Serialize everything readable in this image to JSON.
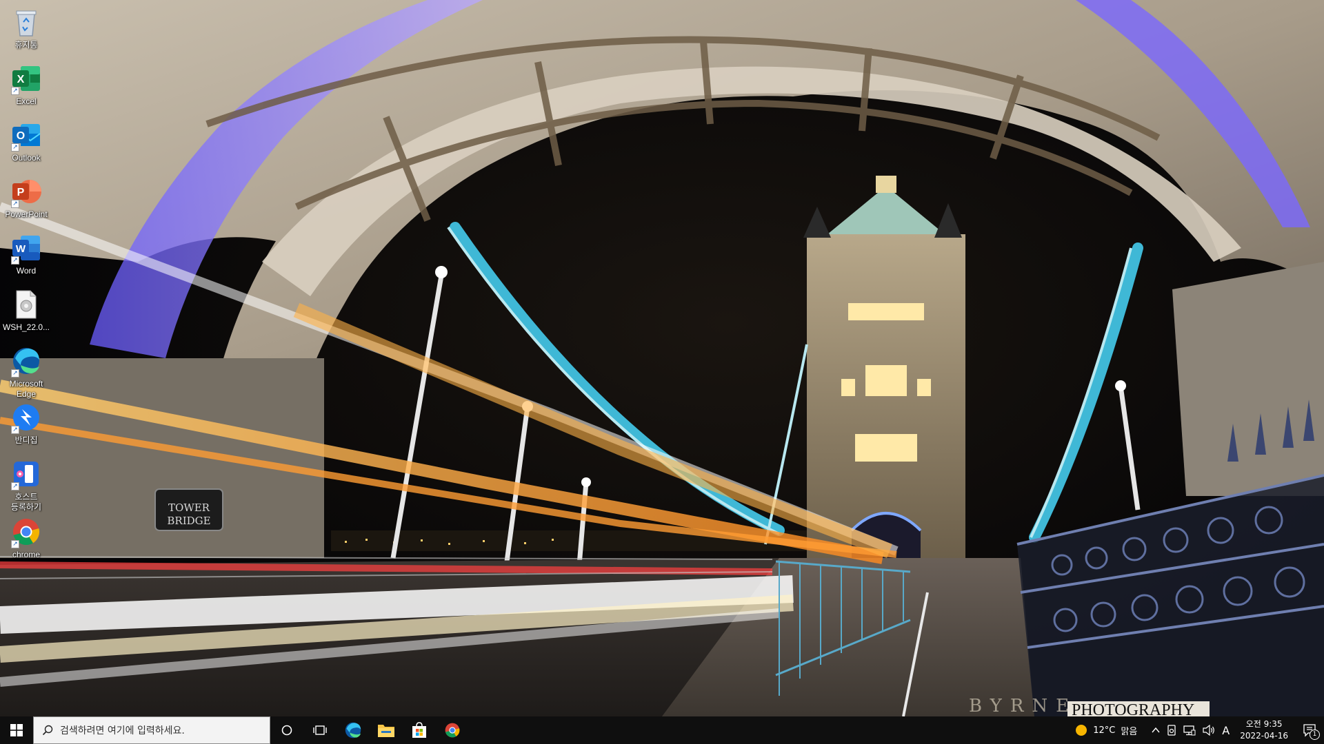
{
  "desktop": {
    "icons": [
      {
        "id": "recycle",
        "label": "휴지통",
        "icon": "recycle-bin-icon"
      },
      {
        "id": "excel",
        "label": "Excel",
        "icon": "excel-icon",
        "color": "#107C41"
      },
      {
        "id": "outlook",
        "label": "Outlook",
        "icon": "outlook-icon",
        "color": "#0F6CBD"
      },
      {
        "id": "powerpoint",
        "label": "PowerPoint",
        "icon": "powerpoint-icon",
        "color": "#C43E1C"
      },
      {
        "id": "word",
        "label": "Word",
        "icon": "word-icon",
        "color": "#185ABD"
      },
      {
        "id": "wsh",
        "label": "WSH_22.0...",
        "icon": "file-icon"
      },
      {
        "id": "edge",
        "label": "Microsoft Edge",
        "icon": "edge-icon"
      },
      {
        "id": "bandizip",
        "label": "반디집",
        "icon": "bandizip-icon",
        "color": "#1E7CF2"
      },
      {
        "id": "host",
        "label": "호스트 등록하기",
        "icon": "host-register-icon",
        "color": "#2468d8"
      },
      {
        "id": "chrome",
        "label": "chrome",
        "icon": "chrome-icon"
      }
    ],
    "wallpaper": {
      "sign_line1": "TOWER",
      "sign_line2": "BRIDGE",
      "watermark_left": "BYRNE",
      "watermark_right": "PHOTOGRAPHY"
    }
  },
  "taskbar": {
    "search_placeholder": "검색하려면 여기에 입력하세요.",
    "pinned": [
      "edge-icon",
      "file-explorer-icon",
      "store-icon",
      "chrome-icon"
    ],
    "weather": {
      "temp": "12°C",
      "condition": "맑음"
    },
    "ime": "A",
    "clock": {
      "time": "오전 9:35",
      "date": "2022-04-16"
    },
    "notification_count": "1",
    "colors": {
      "taskbar": "#101010",
      "accent": "#0078D4"
    }
  }
}
